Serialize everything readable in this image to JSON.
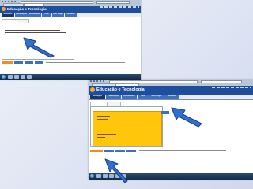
{
  "header": {
    "title": "Educação e Tecnologia"
  },
  "tabs": [
    "Mensagens",
    "Comunicações",
    "Recolhimentos",
    "Perfil",
    "Meus amigos",
    "Atividades"
  ],
  "colors": {
    "header": "#1e4e9c",
    "tab": "#3f6fbf",
    "tab_active": "#14356e",
    "editor_highlight": "#ffc60b",
    "primary_button": "#f08f1f",
    "arrow": "#2f6fd1"
  },
  "icons": [
    "arrow-pointer-icon",
    "windows-start-icon",
    "taskbar-app-icon"
  ]
}
